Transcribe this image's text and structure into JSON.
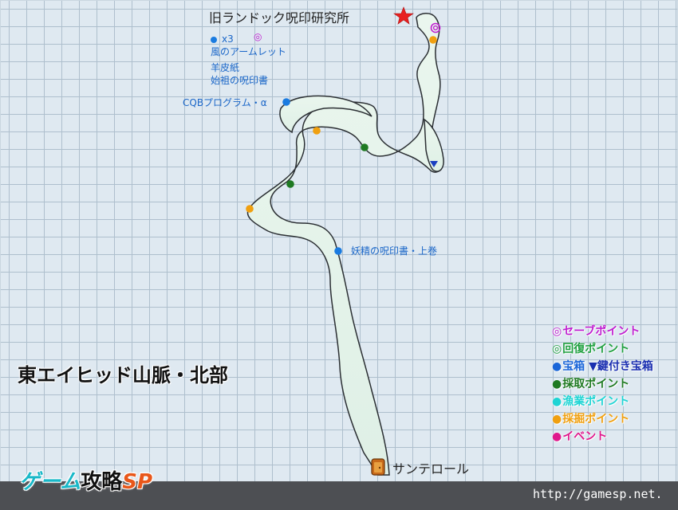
{
  "location_title": "旧ランドック呪印研究所",
  "region_title": "東エイヒッド山脈・北部",
  "exit_label": "サンテロール",
  "loot_lines": [
    "x3",
    "風のアームレット",
    "羊皮紙",
    "始祖の呪印書"
  ],
  "treasure_labels": {
    "cqb": "CQBプログラム・α",
    "fairy": "妖精の呪印書・上巻"
  },
  "legend": [
    {
      "symbol": "◎",
      "text": "セーブポイント",
      "color": "#c020d0"
    },
    {
      "symbol": "◎",
      "text": "回復ポイント",
      "color": "#20a040"
    },
    {
      "symbol": "●",
      "text": "宝箱",
      "color": "#1a66d8",
      "extra_symbol": "▼",
      "extra_text": "鍵付き宝箱",
      "extra_color": "#1a2fb0"
    },
    {
      "symbol": "●",
      "text": "採取ポイント",
      "color": "#1f7a22"
    },
    {
      "symbol": "●",
      "text": "漁業ポイント",
      "color": "#1fd4d4"
    },
    {
      "symbol": "●",
      "text": "採掘ポイント",
      "color": "#f0a010"
    },
    {
      "symbol": "●",
      "text": "イベント",
      "color": "#e0188c"
    }
  ],
  "brand": {
    "part1": "ゲーム",
    "part2": "攻略",
    "part3": "SP"
  },
  "site_url": "http://gamesp.net.",
  "colors": {
    "save": "#c020d0",
    "treasure": "#1a7be0",
    "locked_treasure": "#1a3fc0",
    "gather": "#1f7a22",
    "mining": "#f0a010",
    "goal_star": "#e82020",
    "path_fill": "#e5f4ea"
  },
  "markers": [
    {
      "type": "goal-star",
      "icon": "star-icon"
    },
    {
      "type": "save",
      "icon": "save-point-icon"
    },
    {
      "type": "treasure",
      "icon": "treasure-dot-icon"
    },
    {
      "type": "mining",
      "icon": "mining-dot-icon"
    },
    {
      "type": "gather",
      "icon": "gather-dot-icon"
    },
    {
      "type": "locked-treasure",
      "icon": "locked-chest-icon"
    },
    {
      "type": "exit",
      "icon": "door-icon"
    }
  ]
}
